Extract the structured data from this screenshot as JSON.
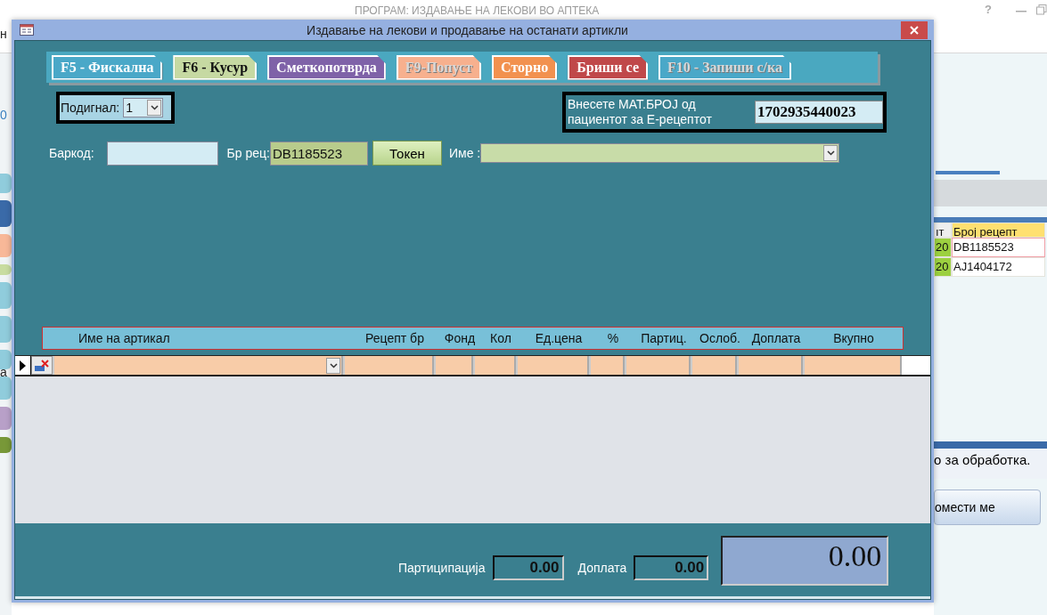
{
  "app": {
    "title": "ПРОГРАМ: ИЗДАВАЊЕ НА ЛЕКОВИ ВО АПТЕКА",
    "help": "?",
    "left_texts": [
      "н",
      "0",
      "а"
    ],
    "table": {
      "columns": [
        "ıт",
        "Број рецепт"
      ],
      "rows": [
        {
          "cells": [
            "20",
            "DB1185523"
          ],
          "selected": true
        },
        {
          "cells": [
            "20",
            "AJ1404172"
          ],
          "selected": false
        }
      ]
    },
    "message": "о за обработка.",
    "button": "омести ме"
  },
  "dialog": {
    "title": "Издавање на лекови и продавање на останати артикли",
    "toolbar": [
      {
        "label": "F5 - Фискална",
        "color": "#4aa8c8",
        "disabled": false
      },
      {
        "label": "F6 - Кусур",
        "color": "#c6d9a2",
        "disabled": false
      },
      {
        "label": "Сметкопотврда",
        "color": "#7f62a8",
        "disabled": false
      },
      {
        "label": "F9-Попуст",
        "color": "#f7b08e",
        "disabled": true
      },
      {
        "label": "Сторно",
        "color": "#f2914f",
        "disabled": false
      },
      {
        "label": "Бриши се",
        "color": "#c0484a",
        "disabled": false
      },
      {
        "label": "F10 - Запиши с/ка",
        "color": "#4aa8c8",
        "disabled": true
      }
    ],
    "lift": {
      "label": "Подигнал:",
      "value": "1"
    },
    "patient_id": {
      "label": "Внесете МАТ.БРОЈ од пациентот за Е-рецептот",
      "value": "1702935440023"
    },
    "barcode": {
      "label": "Баркод:"
    },
    "prescription": {
      "label": "Бр рец:",
      "value": "DB1185523"
    },
    "token_button": "Токен",
    "name": {
      "label": "Име :"
    },
    "columns": [
      "Име на артикал",
      "Рецепт бр",
      "Фонд",
      "Кол",
      "Ед.цена",
      "%",
      "Партиц.",
      "Ослоб.",
      "Доплата",
      "Вкупно"
    ],
    "totals": {
      "participation_label": "Партиципација",
      "participation": "0.00",
      "surcharge_label": "Доплата",
      "surcharge": "0.00",
      "total": "0.00"
    }
  }
}
